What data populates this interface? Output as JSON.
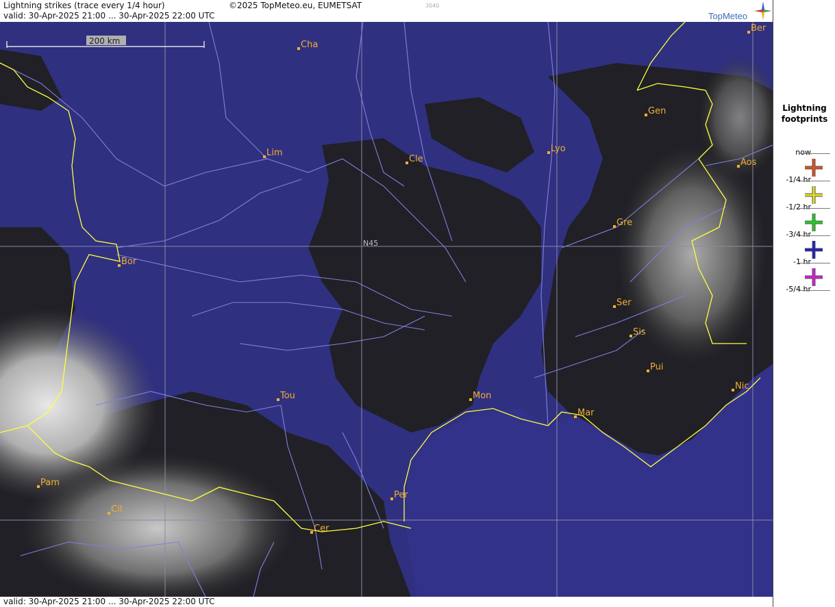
{
  "header": {
    "title": "Lightning strikes (trace every 1/4 hour)",
    "copyright": "©2025 TopMeteo.eu, EUMETSAT",
    "code": "3040",
    "valid": "valid:  30-Apr-2025 21:00 ... 30-Apr-2025 22:00 UTC"
  },
  "logo": {
    "text": "TopMeteo",
    "icon": "compass-star-icon"
  },
  "map": {
    "scale_label": "200 km",
    "grid_label": "N45",
    "colors": {
      "land": "#1e1e24",
      "sea_clear": "#303080",
      "cloud_high": "#e8e8e8",
      "rivers": "#8080e0",
      "border": "#ffff40",
      "city_label": "#f0b030"
    },
    "cities": [
      {
        "name": "Cha"
      },
      {
        "name": "Ber"
      },
      {
        "name": "Gen"
      },
      {
        "name": "Lim"
      },
      {
        "name": "Cle"
      },
      {
        "name": "Lyo"
      },
      {
        "name": "Aos"
      },
      {
        "name": "Gre"
      },
      {
        "name": "Bor"
      },
      {
        "name": "Ser"
      },
      {
        "name": "Sis"
      },
      {
        "name": "Pui"
      },
      {
        "name": "Nic"
      },
      {
        "name": "Tou"
      },
      {
        "name": "Mon"
      },
      {
        "name": "Mar"
      },
      {
        "name": "Pam"
      },
      {
        "name": "Per"
      },
      {
        "name": "Cil"
      },
      {
        "name": "Cer"
      }
    ]
  },
  "footer": {
    "valid": "valid:  30-Apr-2025 21:00 ... 30-Apr-2025 22:00 UTC"
  },
  "legend": {
    "title_line1": "Lightning",
    "title_line2": "footprints",
    "items": [
      {
        "label": "now",
        "color": "#e05020"
      },
      {
        "label": "-1/4 hr",
        "color": "#e0e020"
      },
      {
        "label": "-1/2 hr",
        "color": "#20d020"
      },
      {
        "label": "-3/4 hr",
        "color": "#2020c0"
      },
      {
        "label": "-1 hr",
        "color": "#d020d0"
      },
      {
        "label": "-5/4 hr",
        "color": ""
      }
    ]
  }
}
